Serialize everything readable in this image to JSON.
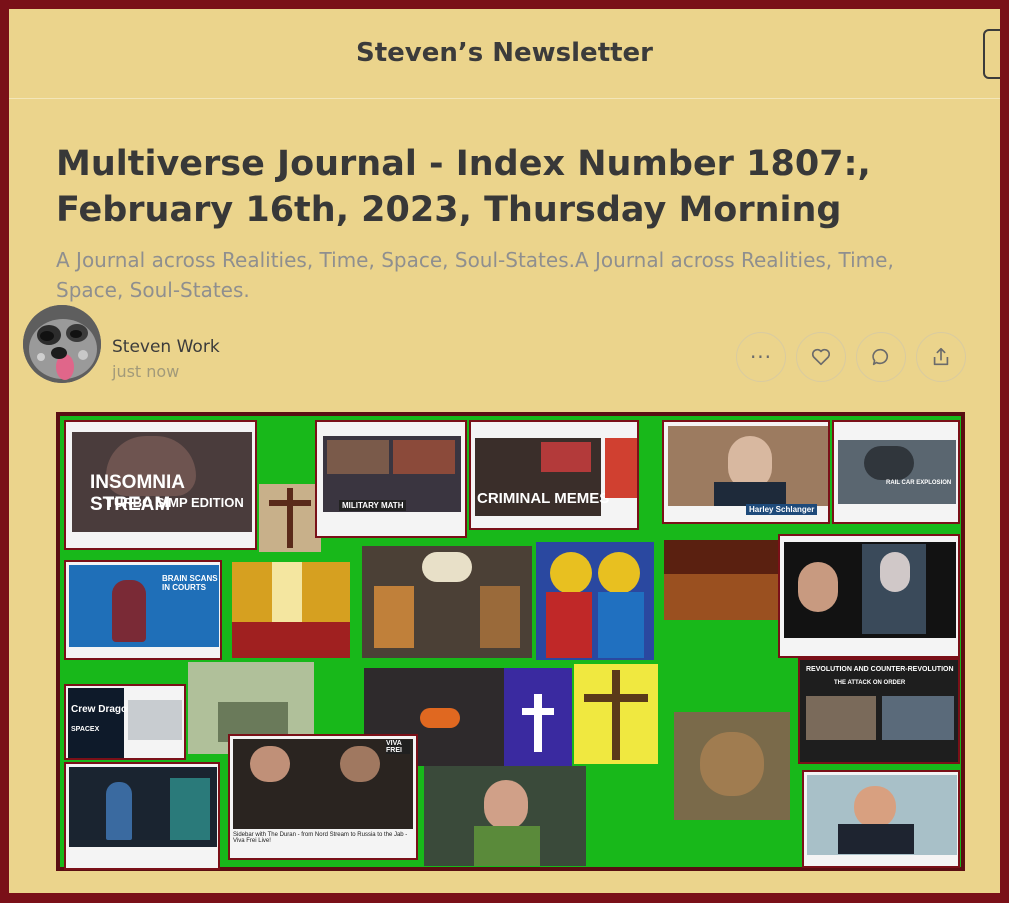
{
  "header": {
    "newsletter_name": "Steven’s Newsletter"
  },
  "post": {
    "title": "Multiverse Journal - Index Number 1807:, February 16th, 2023, Thursday Morning",
    "subtitle": "A Journal across Realities, Time, Space, Soul-States.A Journal across Realities, Time, Space, Soul-States.",
    "author": "Steven Work",
    "timestamp": "just now"
  },
  "actions": [
    {
      "name": "more",
      "icon": "ellipsis-icon"
    },
    {
      "name": "like",
      "icon": "heart-icon"
    },
    {
      "name": "comment",
      "icon": "comment-icon"
    },
    {
      "name": "share",
      "icon": "share-icon"
    }
  ],
  "collage": {
    "insomnia_line1": "INSOMNIA STREAM",
    "insomnia_line2": "TURBO SIMP EDITION",
    "military_math": "MILITARY MATH",
    "criminal_memes": "CRIMINAL MEMES",
    "harley": "Harley Schlanger",
    "rail": "RAIL CAR EXPLOSION",
    "revolution": "REVOLUTION AND COUNTER-REVOLUTION",
    "attack": "THE ATTACK ON ORDER",
    "crew_dragon": "Crew Dragon",
    "spacex": "SPACEX",
    "viva": "VIVA FREI",
    "courts": "BRAIN SCANS IN COURTS",
    "sidebar_caption": "Sidebar with The Duran - from Nord Stream to Russia to the Jab - Viva Frei Live!"
  },
  "colors": {
    "page_bg": "#ebd48c",
    "border": "#7a1018",
    "title": "#383838",
    "subtitle": "#8f8f8f",
    "collage_green": "#18b81a"
  }
}
